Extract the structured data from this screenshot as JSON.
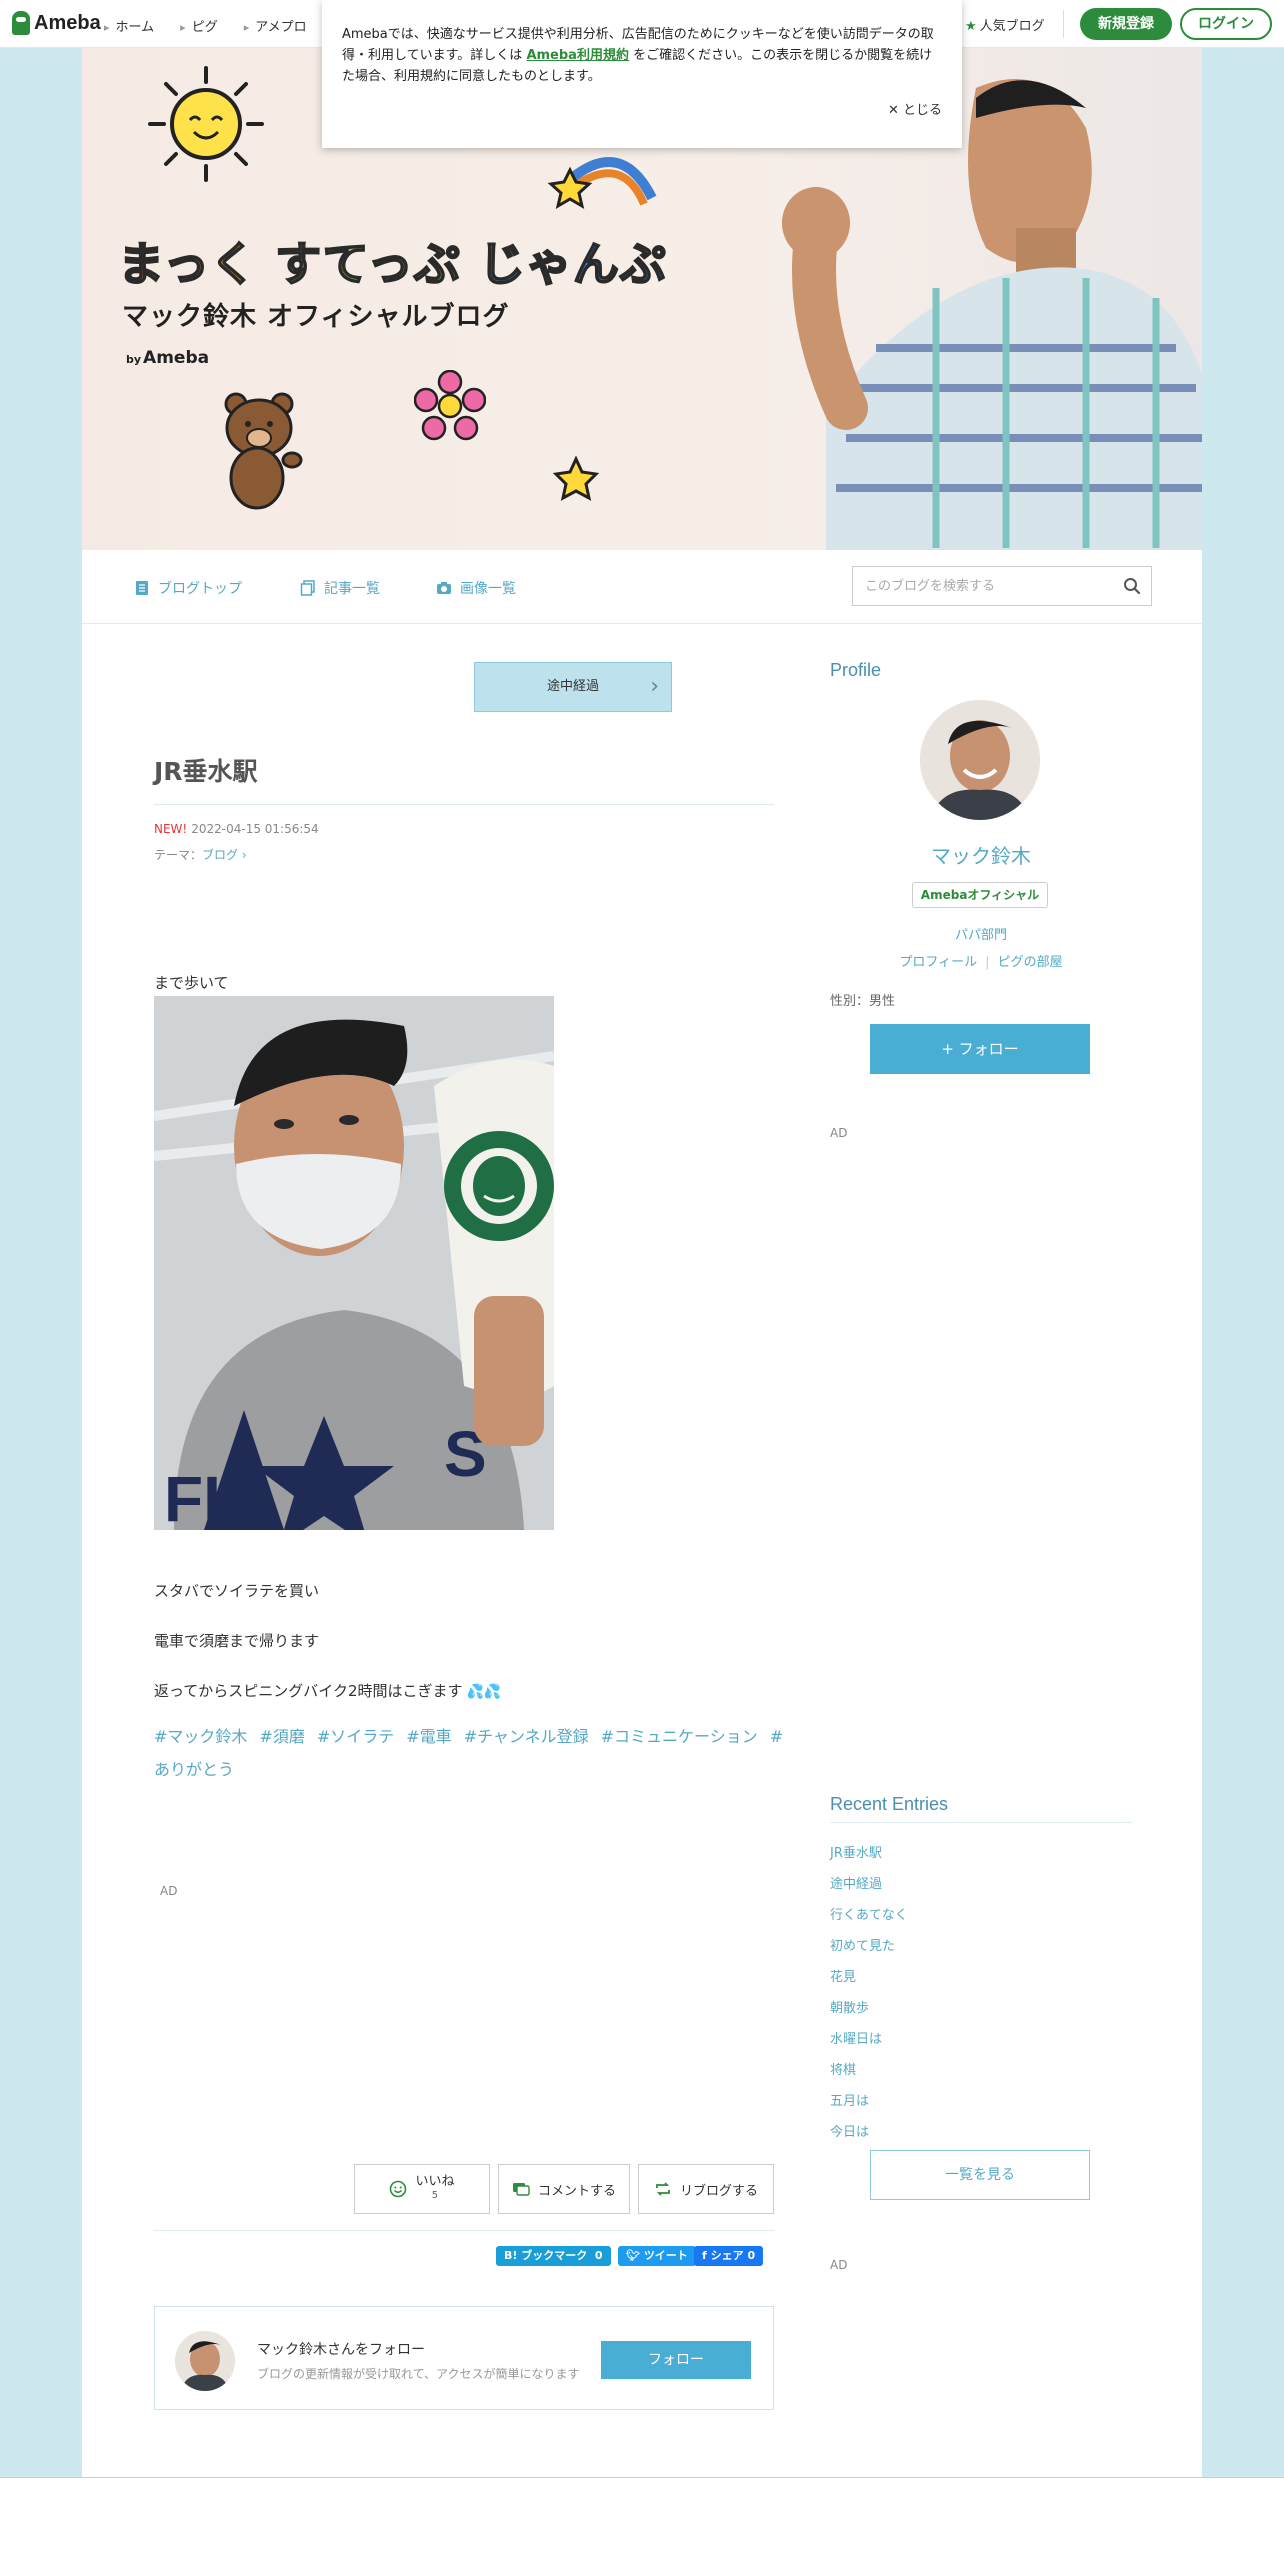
{
  "topbar": {
    "logo_text": "Ameba",
    "nav": [
      "ホーム",
      "ピグ",
      "アメプロ"
    ],
    "popular": "人気ブログ",
    "register": "新規登録",
    "login": "ログイン"
  },
  "cookie": {
    "text_before": "Amebaでは、快適なサービス提供や利用分析、広告配信のためにクッキーなどを使い訪問データの取得・利用しています。詳しくは ",
    "link": "Ameba利用規約",
    "text_after": " をご確認ください。この表示を閉じるか閲覧を続けた場合、利用規約に同意したものとします。",
    "close": "とじる"
  },
  "banner": {
    "title_a": "まっく",
    "title_b": "すてっぷ",
    "title_c": "じゃんぷ",
    "subtitle": "マック鈴木 オフィシャルブログ",
    "by": "by",
    "ameba": "Ameba"
  },
  "blognav": {
    "items": [
      "ブログトップ",
      "記事一覧",
      "画像一覧"
    ],
    "search_placeholder": "このブログを検索する"
  },
  "article": {
    "prev": "途中経過",
    "title": "JR垂水駅",
    "new_label": "NEW!",
    "date": "2022-04-15 01:56:54",
    "theme_label": "テーマ：",
    "theme": "ブログ",
    "lines": [
      "まで歩いて",
      "スタバでソイラテを買い",
      "電車で須磨まで帰ります",
      "返ってからスピニングバイク2時間はこぎます"
    ],
    "hashtags": [
      "#マック鈴木",
      "#須磨",
      "#ソイラテ",
      "#電車",
      "#チャンネル登録",
      "#コミュニケーション",
      "#ありがとう"
    ],
    "ad": "AD",
    "actions": {
      "like": "いいね",
      "like_count": "5",
      "comment": "コメントする",
      "reblog": "リブログする"
    },
    "share": {
      "hatena": "B! ブックマーク",
      "hatena_count": "0",
      "tweet": "ツイート",
      "fb": "シェア",
      "fb_count": "0"
    },
    "follow": {
      "name": "マック鈴木さんをフォロー",
      "desc": "ブログの更新情報が受け取れて、アクセスが簡単になります",
      "button": "フォロー"
    }
  },
  "sidebar": {
    "profile_heading": "Profile",
    "name": "マック鈴木",
    "badge": "Amebaオフィシャル",
    "category": "パパ部門",
    "links": [
      "プロフィール",
      "ピグの部屋"
    ],
    "gender": "性別：男性",
    "follow": "+ フォロー",
    "ad": "AD",
    "recent_heading": "Recent Entries",
    "recent": [
      "JR垂水駅",
      "途中経過",
      "行くあてなく",
      "初めて見た",
      "花見",
      "朝散歩",
      "水曜日は",
      "将棋",
      "五月は",
      "今日は"
    ],
    "see_all": "一覧を見る",
    "ad2": "AD"
  },
  "colors": {
    "brand_green": "#2d8c3c",
    "link_blue": "#55a9c6",
    "follow_blue": "#4aaed4",
    "page_bg": "#cde8ef"
  }
}
